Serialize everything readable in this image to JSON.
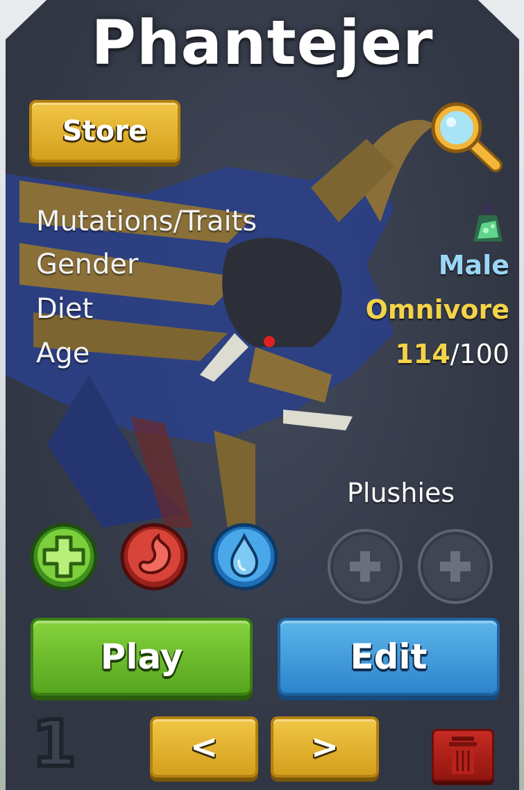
{
  "title": "Phantejer",
  "store": {
    "label": "Store"
  },
  "search": {
    "icon": "magnifier-icon"
  },
  "stats": [
    {
      "label": "Mutations/Traits",
      "icon": "mutation-flask-icon"
    },
    {
      "label": "Gender",
      "value": "Male",
      "color": "#9ad7f5"
    },
    {
      "label": "Diet",
      "value": "Omnivore",
      "color": "#f3d34a"
    },
    {
      "label": "Age",
      "current": "114",
      "separator": "/",
      "max": "100"
    }
  ],
  "needs": [
    {
      "icon": "health-plus-icon",
      "color": "#7cd03b"
    },
    {
      "icon": "stomach-hunger-icon",
      "color": "#d8443a"
    },
    {
      "icon": "water-drop-icon",
      "color": "#4aa8ea"
    }
  ],
  "plushies": {
    "label": "Plushies",
    "slots": [
      "add-plushie-icon",
      "add-plushie-icon"
    ]
  },
  "actions": {
    "play_label": "Play",
    "edit_label": "Edit"
  },
  "slot_number": "1",
  "nav": {
    "prev_label": "<",
    "next_label": ">"
  },
  "trash": {
    "icon": "trash-icon",
    "color": "#c62b22"
  }
}
